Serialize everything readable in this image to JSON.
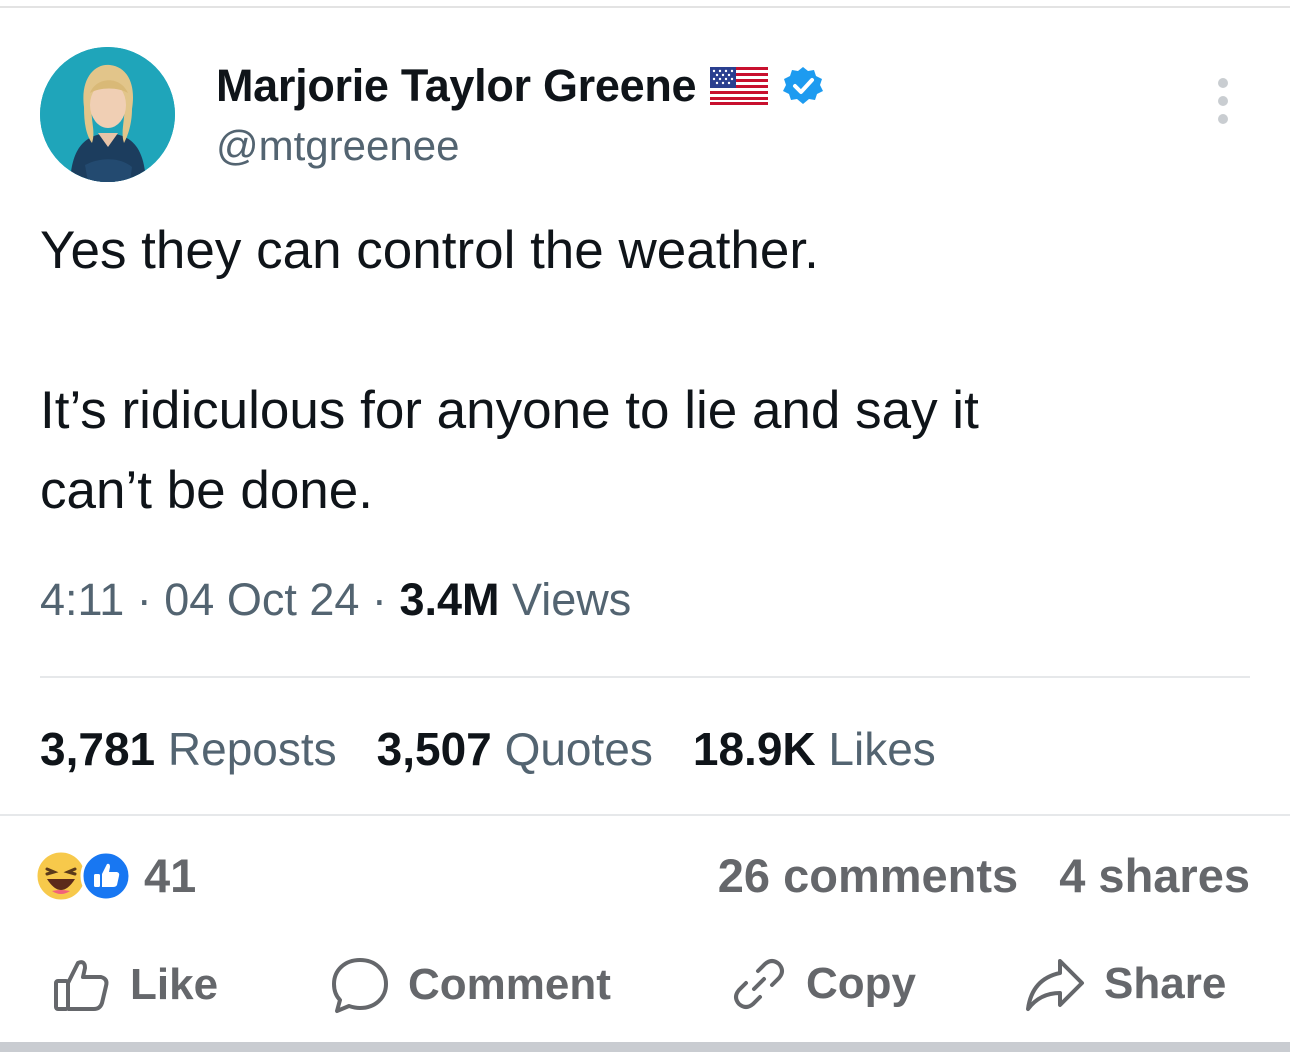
{
  "tweet": {
    "author_name": "Marjorie Taylor Greene",
    "handle": "@mtgreenee",
    "text_line1": "Yes they can control the weather.",
    "text_line2": "It’s ridiculous for anyone to lie and say it",
    "text_line3": "can’t be done.",
    "time": "4:11",
    "date": "04 Oct 24",
    "separator": "·",
    "views_count": "3.4M",
    "views_label": "Views",
    "reposts_count": "3,781",
    "reposts_label": "Reposts",
    "quotes_count": "3,507",
    "quotes_label": "Quotes",
    "likes_count": "18.9K",
    "likes_label": "Likes"
  },
  "facebook": {
    "reaction_count": "41",
    "comments": "26 comments",
    "shares": "4 shares",
    "actions": {
      "like": "Like",
      "comment": "Comment",
      "copy": "Copy",
      "share": "Share"
    }
  },
  "colors": {
    "text_primary": "#0f1419",
    "text_secondary": "#536471",
    "fb_gray": "#65676b",
    "verified_blue": "#1d9bf0",
    "fb_blue": "#1877f2"
  },
  "icons": {
    "verified": "verified-badge-icon",
    "flag": "us-flag-icon",
    "more": "more-vertical-icon",
    "like": "thumbs-up-icon",
    "comment": "speech-bubble-icon",
    "copy": "link-icon",
    "share": "share-arrow-icon"
  }
}
